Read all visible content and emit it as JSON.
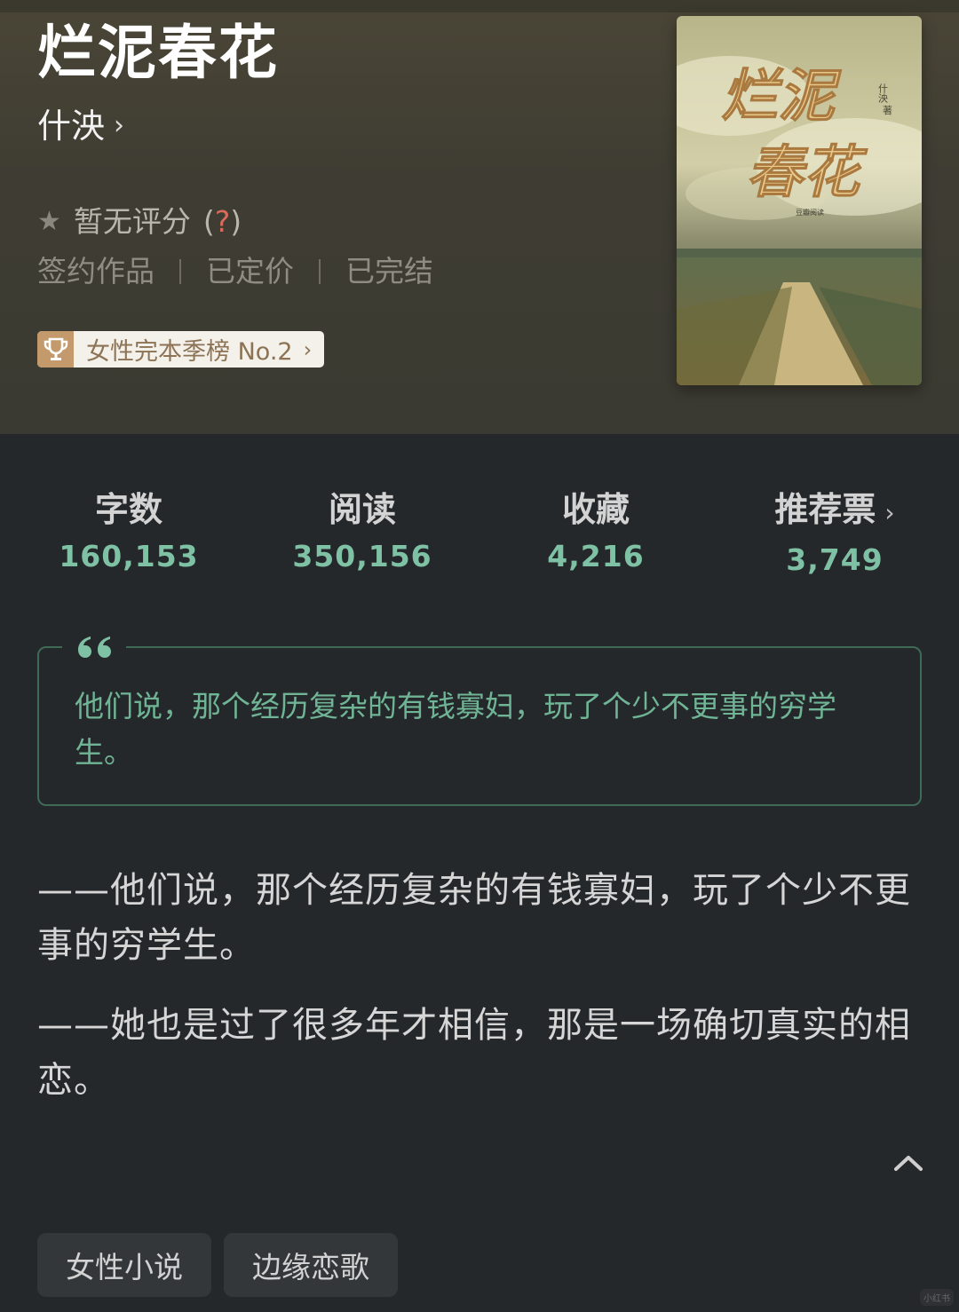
{
  "book": {
    "title": "烂泥春花",
    "author": "什泱",
    "author_chevron": "›",
    "rating_text": "暂无评分",
    "rating_help_open": "(",
    "rating_help_q": "?",
    "rating_help_close": ")",
    "tags_meta": [
      "签约作品",
      "已定价",
      "已完结"
    ],
    "rank_label": "女性完本季榜 No.2",
    "rank_chevron": "›"
  },
  "cover": {
    "title_line1": "烂泥",
    "title_line2": "春花",
    "author_vertical": "什泱",
    "author_suffix": "著",
    "publisher": "豆瓣阅读"
  },
  "stats": [
    {
      "label": "字数",
      "value": "160,153"
    },
    {
      "label": "阅读",
      "value": "350,156"
    },
    {
      "label": "收藏",
      "value": "4,216"
    },
    {
      "label": "推荐票",
      "value": "3,749",
      "chevron": "›"
    }
  ],
  "quote": {
    "text": "他们说，那个经历复杂的有钱寡妇，玩了个少不更事的穷学生。"
  },
  "description": [
    "——他们说，那个经历复杂的有钱寡妇，玩了个少不更事的穷学生。",
    "——她也是过了很多年才相信，那是一场确切真实的相恋。"
  ],
  "genre_tags": [
    "女性小说",
    "边缘恋歌"
  ],
  "watermark": "小红书",
  "colors": {
    "accent_green": "#7fc1a4",
    "quote_border": "#3f6a58",
    "rank_badge": "#c49a6c",
    "background": "#25282b"
  },
  "icons": [
    "star-icon",
    "trophy-icon",
    "chevron-right-icon",
    "quote-mark-icon",
    "chevron-up-icon"
  ]
}
